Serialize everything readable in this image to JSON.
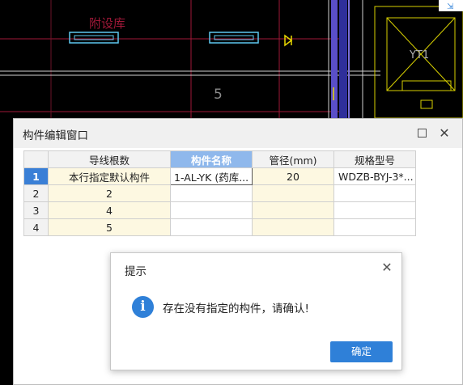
{
  "cad": {
    "room_label": "附设库",
    "dim_label": "5",
    "room_label_right": "YT1"
  },
  "window": {
    "title": "构件编辑窗口",
    "columns": [
      "导线根数",
      "构件名称",
      "管径(mm)",
      "规格型号"
    ],
    "rows": [
      {
        "num": "1",
        "cells": [
          "本行指定默认构件",
          "1-AL-YK (药库...",
          "20",
          "WDZB-BYJ-3*..."
        ]
      },
      {
        "num": "2",
        "cells": [
          "2",
          "",
          "",
          ""
        ]
      },
      {
        "num": "3",
        "cells": [
          "4",
          "",
          "",
          ""
        ]
      },
      {
        "num": "4",
        "cells": [
          "5",
          "",
          "",
          ""
        ]
      }
    ]
  },
  "dialog": {
    "title": "提示",
    "message": "存在没有指定的构件，请确认!",
    "ok_label": "确定",
    "icon": "info-icon"
  }
}
